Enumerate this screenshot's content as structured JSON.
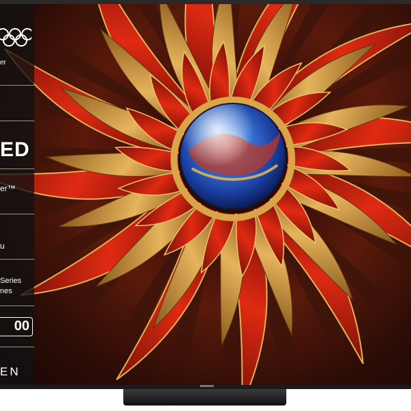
{
  "side_panel": {
    "olympic_partner_text": "er",
    "display_tech": "ED",
    "audio_tech": "er™",
    "refresh_rate": "u",
    "series_line1": "Series",
    "series_line2": "nes",
    "size_badge": "00",
    "brand_text": "EN"
  },
  "colors": {
    "bezel": "#2a2a2a",
    "panel_bg": "#121212",
    "petal_red": "#c8220f",
    "petal_gold": "#d8a24a",
    "orb_blue": "#1f4fb0"
  }
}
